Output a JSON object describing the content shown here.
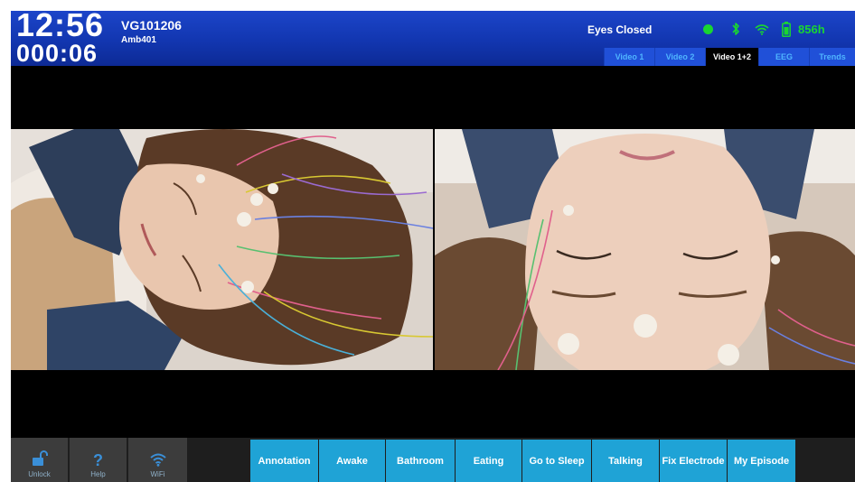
{
  "header": {
    "clock": "12:56",
    "elapsed": "000:06",
    "patient_id": "VG101206",
    "device_id": "Amb401",
    "state": "Eyes Closed",
    "battery": "856h",
    "colors": {
      "header_blue": "#1236b0",
      "status_green": "#19d631",
      "tab_text": "#4fb5ff"
    },
    "icons": [
      "recording-indicator",
      "bluetooth-icon",
      "wifi-icon",
      "battery-icon"
    ]
  },
  "tabs": [
    {
      "label": "Video 1",
      "active": false
    },
    {
      "label": "Video 2",
      "active": false
    },
    {
      "label": "Video 1+2",
      "active": true
    },
    {
      "label": "EEG",
      "active": false
    },
    {
      "label": "Trends",
      "active": false
    }
  ],
  "system_buttons": [
    {
      "label": "Unlock",
      "icon": "unlock-icon"
    },
    {
      "label": "Help",
      "icon": "help-icon"
    },
    {
      "label": "WiFi",
      "icon": "wifi-icon"
    }
  ],
  "event_buttons": [
    {
      "label": "Annotation"
    },
    {
      "label": "Awake"
    },
    {
      "label": "Bathroom"
    },
    {
      "label": "Eating"
    },
    {
      "label": "Go to Sleep"
    },
    {
      "label": "Talking"
    },
    {
      "label": "Fix Electrode"
    },
    {
      "label": "My Episode"
    }
  ],
  "event_button_color": "#1fa3d6"
}
